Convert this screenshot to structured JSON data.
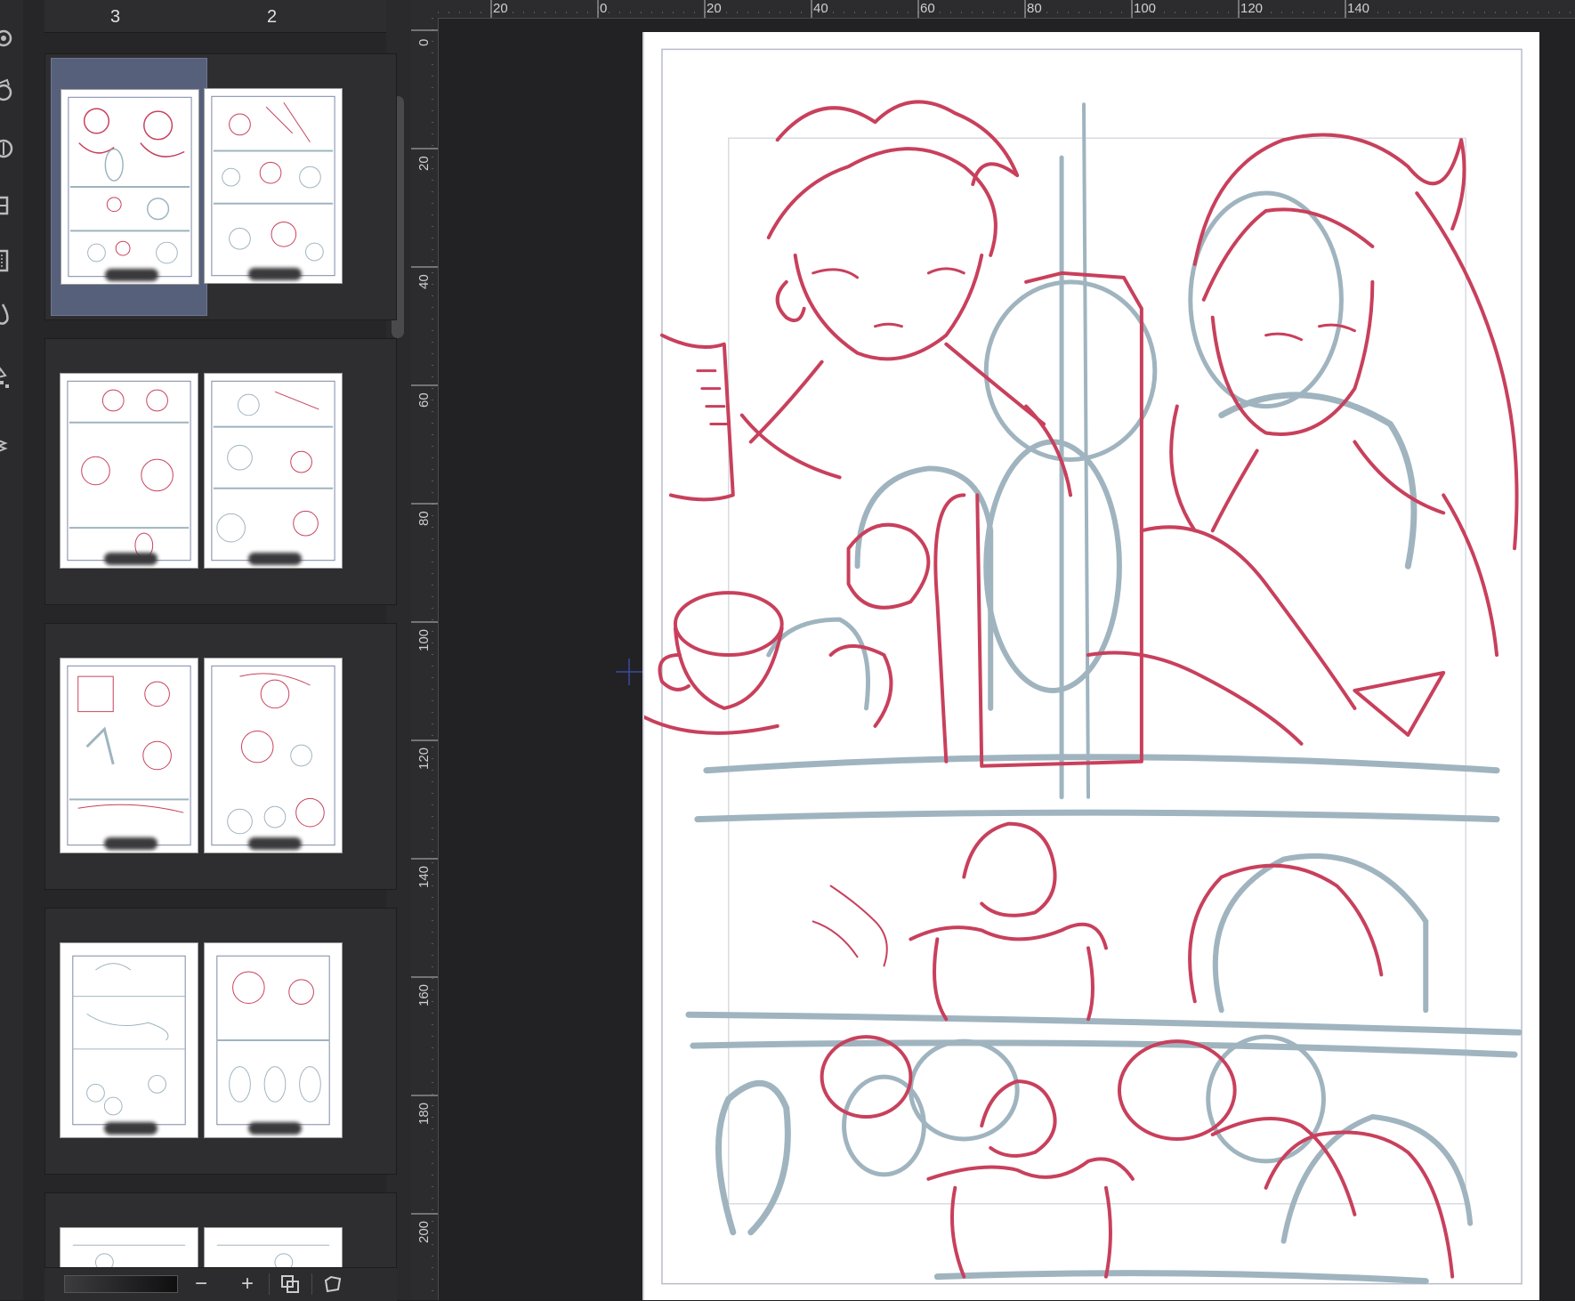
{
  "page_manager": {
    "column_headers": [
      "3",
      "2"
    ],
    "spreads": [
      {
        "left_page": "sketch",
        "right_page": "sketch",
        "selected": "left"
      },
      {
        "left_page": "sketch",
        "right_page": "sketch"
      },
      {
        "left_page": "sketch",
        "right_page": "sketch"
      },
      {
        "left_page": "sketch",
        "right_page": "sketch"
      },
      {
        "left_page": "sketch",
        "right_page": "sketch"
      }
    ],
    "bottom_bar": {
      "zoom_out_label": "−",
      "zoom_in_label": "+"
    }
  },
  "canvas": {
    "ruler_top_labels": [
      "20",
      "0",
      "20",
      "40",
      "60",
      "80",
      "100",
      "120",
      "140"
    ],
    "ruler_left_labels": [
      "0",
      "20",
      "40",
      "60",
      "80",
      "100",
      "120",
      "140",
      "160",
      "180",
      "200"
    ]
  },
  "colors": {
    "sketch_red": "#c8405c",
    "sketch_blue": "#9fb4bf",
    "panel_bg": "#262628",
    "selected_page": "#56607a"
  },
  "icons": [
    "settings-icon",
    "layer-icon",
    "color-wheel-icon",
    "panel-icon",
    "timeline-icon",
    "drop-icon",
    "material-icon",
    "stack-icon",
    "zoom-slider-icon",
    "fit-icon",
    "rotate-icon"
  ]
}
